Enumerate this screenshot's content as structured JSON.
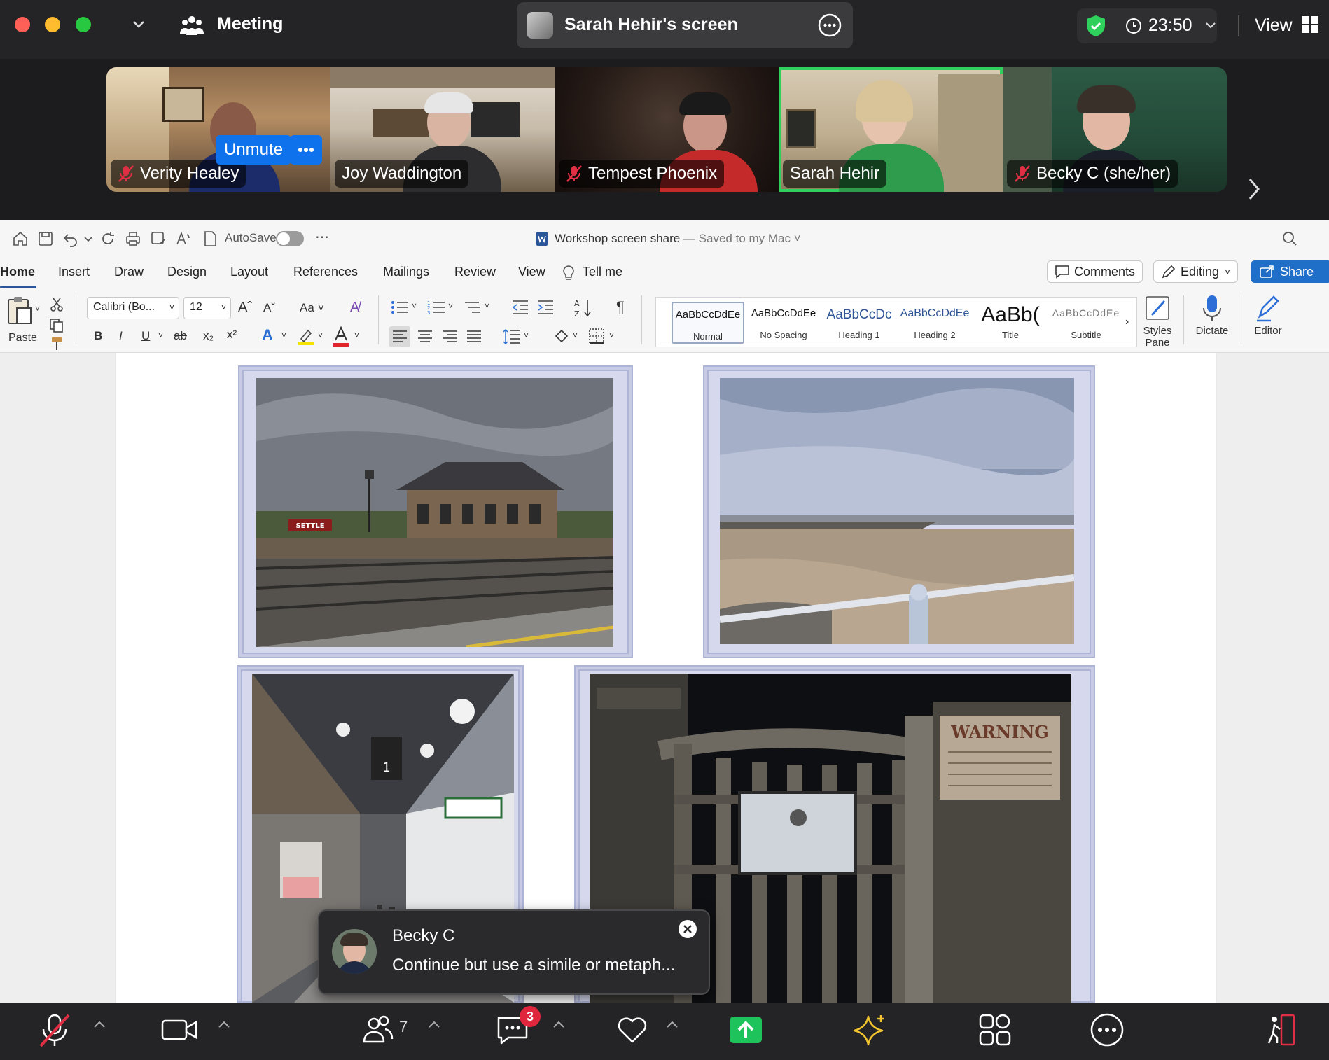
{
  "topbar": {
    "meeting_label": "Meeting",
    "screen_share_title": "Sarah Hehir's screen",
    "time": "23:50",
    "view_label": "View",
    "security_color": "#2fd05b"
  },
  "video_strip": {
    "unmute_label": "Unmute",
    "participants": [
      {
        "name": "Verity Healey",
        "muted": true
      },
      {
        "name": "Joy Waddington",
        "muted": false
      },
      {
        "name": "Tempest Phoenix",
        "muted": true
      },
      {
        "name": "Sarah Hehir",
        "muted": false,
        "active_speaker": true
      },
      {
        "name": "Becky C (she/her)",
        "muted": true
      }
    ]
  },
  "word": {
    "autosave_label": "AutoSave",
    "doc_title": "Workshop screen share",
    "doc_saved": "— Saved to my Mac",
    "tabs": [
      "Home",
      "Insert",
      "Draw",
      "Design",
      "Layout",
      "References",
      "Mailings",
      "Review",
      "View"
    ],
    "tell_me": "Tell me",
    "comments_label": "Comments",
    "editing_label": "Editing",
    "share_label": "Share",
    "paste_label": "Paste",
    "font_name": "Calibri (Bo...",
    "font_size": "12",
    "styles": [
      {
        "sample": "AaBbCcDdEe",
        "name": "Normal"
      },
      {
        "sample": "AaBbCcDdEe",
        "name": "No Spacing"
      },
      {
        "sample": "AaBbCcDc",
        "name": "Heading 1"
      },
      {
        "sample": "AaBbCcDdEe",
        "name": "Heading 2"
      },
      {
        "sample": "AaBb(",
        "name": "Title"
      },
      {
        "sample": "AaBbCcDdEe",
        "name": "Subtitle"
      }
    ],
    "styles_pane_label_1": "Styles",
    "styles_pane_label_2": "Pane",
    "dictate_label": "Dictate",
    "editor_label": "Editor",
    "photos": {
      "station_sign": "SETTLE",
      "market_sign_number": "1",
      "warning_sign": "WARNING"
    }
  },
  "chat_toast": {
    "sender": "Becky C",
    "message": "Continue but use a simile or metaph..."
  },
  "bottombar": {
    "participants_count": "7",
    "chat_badge": "3",
    "share_color": "#1fc35b"
  }
}
